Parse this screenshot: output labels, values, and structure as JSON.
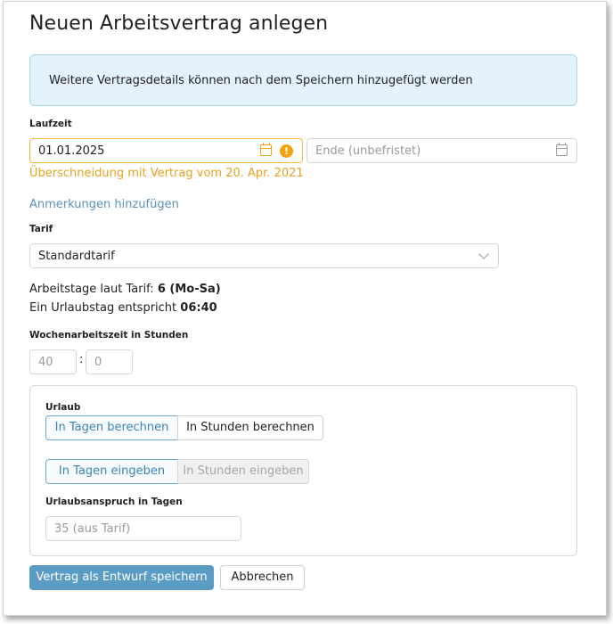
{
  "dialog": {
    "title": "Neuen Arbeitsvertrag anlegen",
    "info": "Weitere Vertragsdetails können nach dem Speichern hinzugefügt werden"
  },
  "laufzeit": {
    "label": "Laufzeit",
    "start_value": "01.01.2025",
    "end_placeholder": "Ende (unbefristet)",
    "warning_icon": "warning-icon",
    "warning": "Überschneidung mit Vertrag vom 20. Apr. 2021",
    "warning_color": "#e8a11e"
  },
  "anmerkungen_link": "Anmerkungen hinzufügen",
  "tarif": {
    "label": "Tarif",
    "selected": "Standardtarif",
    "arbeitstage_prefix": "Arbeitstage laut Tarif: ",
    "arbeitstage_value": "6 (Mo-Sa)",
    "urlaubstag_prefix": "Ein Urlaubstag entspricht ",
    "urlaubstag_value": "06:40"
  },
  "wochenarbeitszeit": {
    "label": "Wochenarbeitszeit in Stunden",
    "hours_placeholder": "40",
    "separator": ":",
    "minutes_placeholder": "0"
  },
  "urlaub": {
    "label": "Urlaub",
    "calc_days": "In Tagen berechnen",
    "calc_hours": "In Stunden berechnen",
    "input_days": "In Tagen eingeben",
    "input_hours": "In Stunden eingeben",
    "anspruch_label": "Urlaubsanspruch in Tagen",
    "anspruch_placeholder": "35 (aus Tarif)"
  },
  "actions": {
    "save": "Vertrag als Entwurf speichern",
    "cancel": "Abbrechen"
  },
  "colors": {
    "accent": "#5a9cc4",
    "link": "#5a8fba",
    "info_bg": "#e4f2fc",
    "warning": "#f2a30f"
  }
}
